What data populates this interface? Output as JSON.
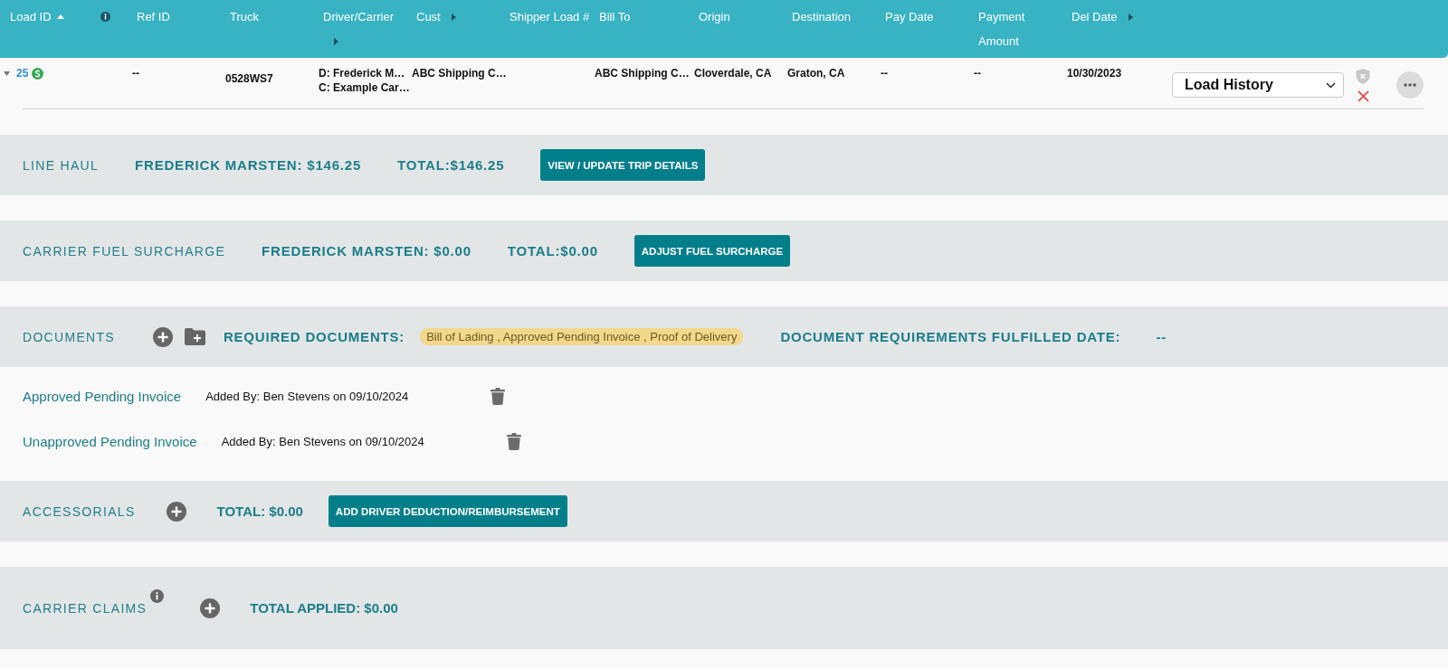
{
  "table": {
    "columns": [
      {
        "label": "Load ID",
        "kind": "sorted"
      },
      {
        "kind": "info"
      },
      {
        "label": "Ref ID",
        "kind": "text"
      },
      {
        "label": "Truck",
        "kind": "text"
      },
      {
        "label": "Driver/Carrier",
        "kind": "menu"
      },
      {
        "label": "Cust",
        "kind": "menu"
      },
      {
        "label": "Shipper Load #",
        "kind": "text"
      },
      {
        "label": "Bill To",
        "kind": "text"
      },
      {
        "label": "Origin",
        "kind": "text"
      },
      {
        "label": "Destination",
        "kind": "text"
      },
      {
        "label": "Pay Date",
        "kind": "text"
      },
      {
        "label": "Payment Amount",
        "kind": "text"
      },
      {
        "label": "Del Date",
        "kind": "menu"
      }
    ],
    "rows": [
      {
        "expanded": true,
        "load_id": "25",
        "ref_id": "--",
        "truck": "0528WS7",
        "driver": "D: Frederick M…",
        "carrier": "C: Example Car…",
        "cust": "ABC Shipping C…",
        "bill_to": "ABC Shipping C…",
        "origin": "Cloverdale, CA",
        "destination": "Graton, CA",
        "pay_date": "--",
        "payment_amount": "--",
        "del_date": "10/30/2023",
        "action": "Load History"
      }
    ]
  },
  "sections": [
    {
      "kind": "summary",
      "title": "LINE HAUL",
      "driver_total": "FREDERICK MARSTEN: $146.25",
      "total": "TOTAL:$146.25",
      "button": "VIEW / UPDATE TRIP DETAILS"
    },
    {
      "kind": "summary",
      "title": "CARRIER FUEL SURCHARGE",
      "driver_total": "FREDERICK MARSTEN: $0.00",
      "total": "TOTAL:$0.00",
      "button": "ADJUST FUEL SURCHARGE"
    },
    {
      "kind": "documents",
      "title": "DOCUMENTS",
      "required_label": "REQUIRED DOCUMENTS:",
      "required_docs": "Bill of Lading , Approved Pending Invoice , Proof of Delivery",
      "fulfilled_label": "DOCUMENT REQUIREMENTS FULFILLED DATE:",
      "fulfilled_date": "--",
      "files": [
        {
          "name": "Approved Pending Invoice",
          "added_by": "Added By: Ben Stevens on 09/10/2024"
        },
        {
          "name": "Unapproved Pending Invoice",
          "added_by": "Added By: Ben Stevens on 09/10/2024"
        }
      ]
    },
    {
      "kind": "accessorials",
      "title": "ACCESSORIALS",
      "total": "TOTAL: $0.00",
      "button": "ADD DRIVER DEDUCTION/REIMBURSEMENT"
    },
    {
      "kind": "claims",
      "title": "CARRIER CLAIMS",
      "total": "TOTAL APPLIED: $0.00"
    }
  ]
}
